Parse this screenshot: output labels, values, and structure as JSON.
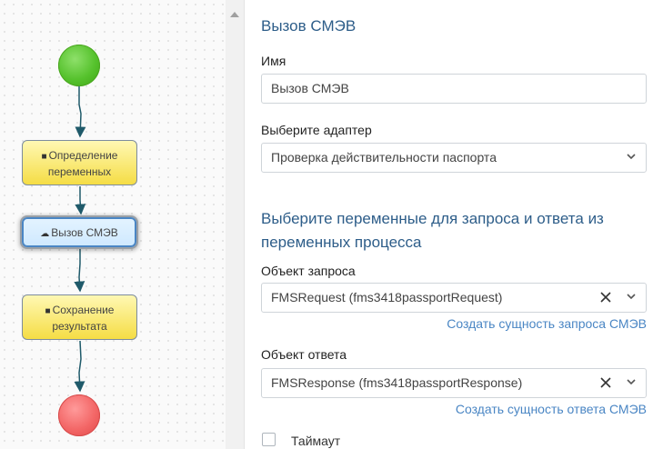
{
  "diagram": {
    "tasks": [
      {
        "icon": "book-icon",
        "label_line1": "Определение",
        "label_line2": "переменных"
      },
      {
        "icon": "cloud-upload-icon",
        "label": "Вызов СМЭВ"
      },
      {
        "icon": "book-icon",
        "label_line1": "Сохранение",
        "label_line2": "результата"
      }
    ],
    "colors": {
      "start": "#56c22d",
      "end": "#f36767",
      "task": "#f5dd45",
      "selected": "#cfe9ff",
      "edge": "#1f5a6a"
    }
  },
  "panel": {
    "title": "Вызов СМЭВ",
    "name_label": "Имя",
    "name_value": "Вызов СМЭВ",
    "adapter_label": "Выберите адаптер",
    "adapter_value": "Проверка действительности паспорта",
    "vars_heading": "Выберите переменные для запроса и ответа из переменных процесса",
    "request_label": "Объект запроса",
    "request_value": "FMSRequest (fms3418passportRequest)",
    "request_link": "Создать сущность запроса СМЭВ",
    "response_label": "Объект ответа",
    "response_value": "FMSResponse (fms3418passportResponse)",
    "response_link": "Создать сущность ответа СМЭВ",
    "timeout_label": "Таймаут",
    "timeout_checked": false
  },
  "accent": "#2d5d89",
  "link_color": "#4a86c4"
}
